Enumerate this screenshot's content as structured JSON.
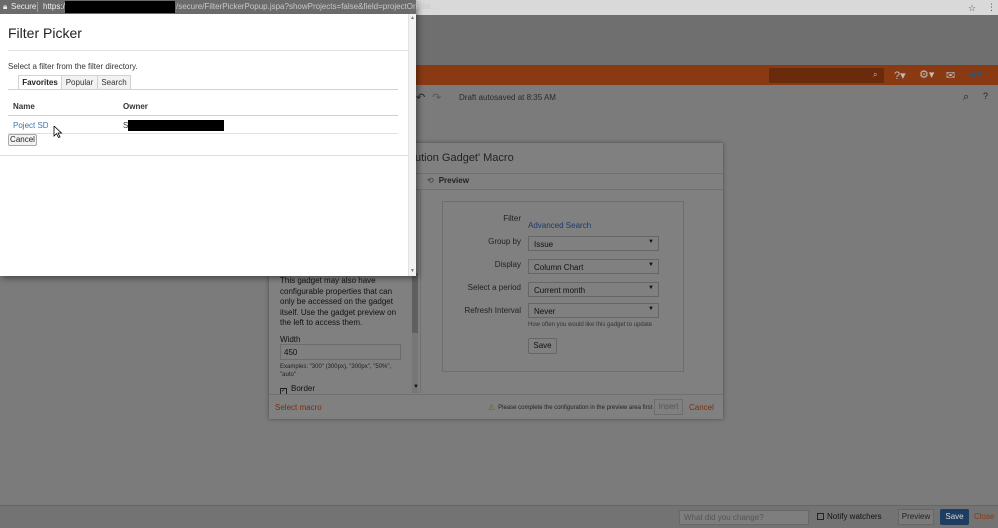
{
  "popup": {
    "address": {
      "secure_label": "Secure",
      "scheme": "https:/",
      "path": "/secure/FilterPickerPopup.jspa?showProjects=false&field=projectOrFilte..."
    },
    "title": "Filter Picker",
    "instruction": "Select a filter from the filter directory.",
    "tabs": [
      {
        "label": "Favorites",
        "active": true
      },
      {
        "label": "Popular",
        "active": false
      },
      {
        "label": "Search",
        "active": false
      }
    ],
    "table": {
      "columns": [
        "Name",
        "Owner"
      ],
      "rows": [
        {
          "name": "Poject SD",
          "owner": "S"
        }
      ]
    },
    "cancel_label": "Cancel"
  },
  "background": {
    "draft_status": "Draft autosaved at 8:35 AM",
    "footer": {
      "change_placeholder": "What did you change?",
      "notify_label": "Notify watchers",
      "preview_label": "Preview",
      "save_label": "Save",
      "close_label": "Close"
    }
  },
  "macro": {
    "title": "ution Gadget' Macro",
    "preview_tab": "Preview",
    "left": {
      "description": "This gadget may also have configurable properties that can only be accessed on the gadget itself. Use the gadget preview on the left to access them.",
      "width_label": "Width",
      "width_value": "450",
      "width_hint": "Examples: \"300\" (300px), \"300px\", \"50%\", \"auto\"",
      "border_label": "Border"
    },
    "gadget": {
      "filter_label": "Filter",
      "filter_link": "Advanced Search",
      "group_by_label": "Group by",
      "group_by_value": "Issue",
      "display_label": "Display",
      "display_value": "Column Chart",
      "period_label": "Select a period",
      "period_value": "Current month",
      "refresh_label": "Refresh Interval",
      "refresh_value": "Never",
      "refresh_hint": "How often you would like this gadget to update",
      "save_label": "Save"
    },
    "footer": {
      "select_macro": "Select macro",
      "warning": "Please complete the configuration in the preview area first",
      "insert_label": "Insert",
      "cancel_label": "Cancel"
    }
  },
  "icons": {
    "lock": "lock-icon",
    "star": "star-icon",
    "refresh": "refresh-icon",
    "warning": "warning-icon"
  }
}
